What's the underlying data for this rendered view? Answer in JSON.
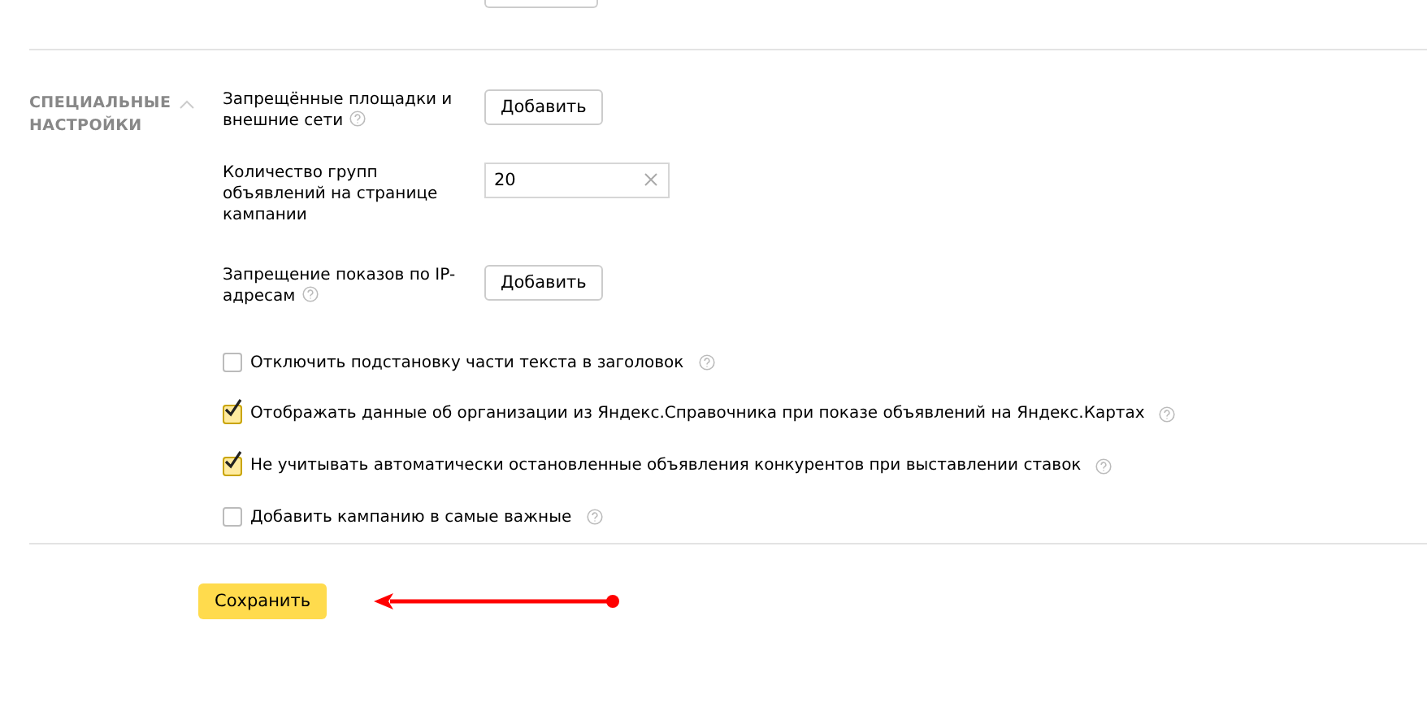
{
  "section": {
    "title": "СПЕЦИАЛЬНЫЕ НАСТРОЙКИ",
    "expanded": true
  },
  "fields": [
    {
      "kind": "button",
      "label": "Запрещённые площадки и внешние сети",
      "help": true,
      "button": "Добавить"
    },
    {
      "kind": "input",
      "label": "Количество групп объявлений на странице кампании",
      "help": false,
      "value": "20"
    },
    {
      "kind": "button",
      "label": "Запрещение показов по IP-адресам",
      "help": true,
      "button": "Добавить"
    }
  ],
  "options": [
    {
      "label": "Отключить подстановку части текста в заголовок",
      "checked": false
    },
    {
      "label": "Отображать данные об организации из Яндекс.Справочника при показе объявлений на Яндекс.Картах",
      "checked": true
    },
    {
      "label": "Не учитывать автоматически остановленные объявления конкурентов при выставлении ставок",
      "checked": true
    },
    {
      "label": "Добавить кампанию в самые важные",
      "checked": false
    }
  ],
  "save_button": "Сохранить"
}
